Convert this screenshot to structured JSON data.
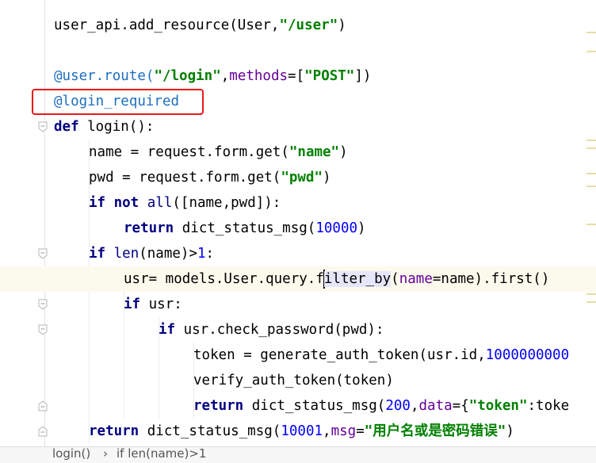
{
  "editor": {
    "lines": [
      {
        "id": "l1",
        "tokens": [
          "user_api.add_resource(User,",
          "\"/user\"",
          ")"
        ]
      },
      {
        "id": "l3",
        "tokens": [
          "@user.route(",
          "\"/login\"",
          ",",
          "methods",
          "=[",
          "\"POST\"",
          "])"
        ]
      },
      {
        "id": "l4",
        "tokens": [
          "@login_required"
        ]
      },
      {
        "id": "l5",
        "tokens": [
          "def",
          " login():"
        ]
      },
      {
        "id": "l6",
        "tokens": [
          "name = request.form.get(",
          "\"name\"",
          ")"
        ]
      },
      {
        "id": "l7",
        "tokens": [
          "pwd = request.form.get(",
          "\"pwd\"",
          ")"
        ]
      },
      {
        "id": "l8",
        "tokens": [
          "if not",
          " ",
          "all",
          "([name,pwd]):"
        ]
      },
      {
        "id": "l9",
        "tokens": [
          "return",
          " dict_status_msg(",
          "10000",
          ")"
        ]
      },
      {
        "id": "l10",
        "tokens": [
          "if",
          " ",
          "len",
          "(name)>",
          "1",
          ":"
        ]
      },
      {
        "id": "l11",
        "tokens": [
          "usr= models.User.query.f",
          "ilter_by",
          "(",
          "name",
          "=name).first()"
        ]
      },
      {
        "id": "l12",
        "tokens": [
          "if",
          " usr:"
        ]
      },
      {
        "id": "l13",
        "tokens": [
          "if",
          " usr.check_password(pwd):"
        ]
      },
      {
        "id": "l14",
        "tokens": [
          "token = generate_auth_token(usr.id,",
          "1000000000"
        ]
      },
      {
        "id": "l15",
        "tokens": [
          "verify_auth_token(token)"
        ]
      },
      {
        "id": "l16",
        "tokens": [
          "return",
          " dict_status_msg(",
          "200",
          ",",
          "data",
          "={",
          "\"token\"",
          ":toke"
        ]
      },
      {
        "id": "l17",
        "tokens": [
          "return",
          " dict_status_msg(",
          "10001",
          ",",
          "msg",
          "=",
          "\"用户名或是密码错误\"",
          ")"
        ]
      }
    ]
  },
  "breadcrumb": {
    "items": [
      "login()",
      "if len(name)>1"
    ],
    "separator": "›"
  },
  "colors": {
    "keyword": "#000080",
    "string": "#008000",
    "number": "#0000ff",
    "decorator": "#1e6fbf",
    "param": "#660099",
    "highlight_box": "#e8191e"
  }
}
